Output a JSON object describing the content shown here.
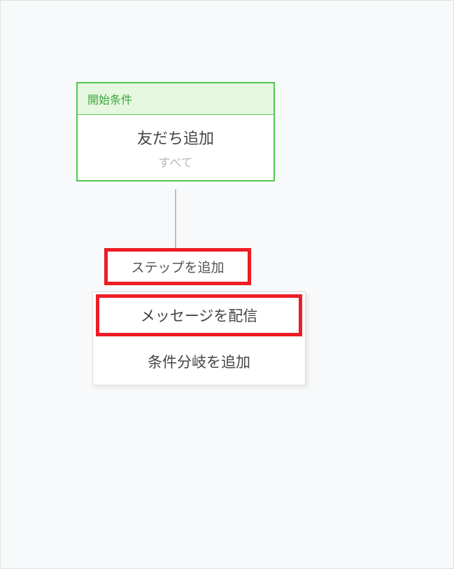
{
  "start": {
    "header": "開始条件",
    "title": "友だち追加",
    "sub": "すべて"
  },
  "addStep": {
    "label": "ステップを追加"
  },
  "menu": {
    "items": [
      {
        "label": "メッセージを配信",
        "highlighted": true
      },
      {
        "label": "条件分岐を追加",
        "highlighted": false
      }
    ]
  }
}
